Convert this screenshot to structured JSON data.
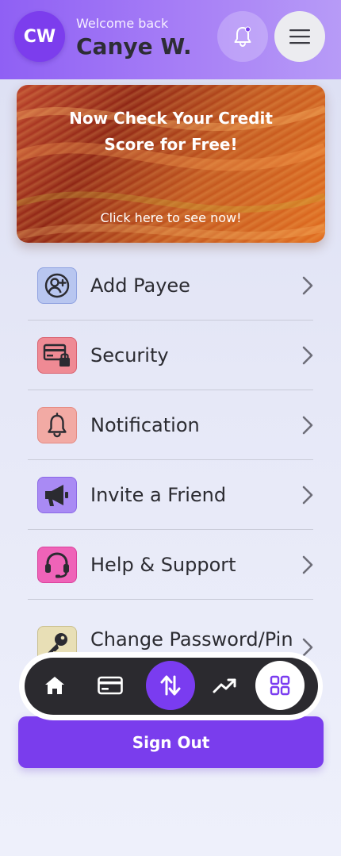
{
  "header": {
    "avatar_initials": "CW",
    "welcome_text": "Welcome back",
    "user_name": "Canye W.",
    "notification_icon": "bell-icon",
    "menu_icon": "hamburger-icon"
  },
  "promo": {
    "title": "Now Check Your Credit Score for Free!",
    "cta": "Click here to see now!"
  },
  "menu": {
    "items": [
      {
        "label": "Add Payee",
        "icon": "add-user-icon",
        "color": "#b8c6f0"
      },
      {
        "label": "Security",
        "icon": "card-lock-icon",
        "color": "#ef8a94"
      },
      {
        "label": "Notification",
        "icon": "bell-icon",
        "color": "#f2aaa4"
      },
      {
        "label": "Invite a Friend",
        "icon": "megaphone-icon",
        "color": "#a98af4"
      },
      {
        "label": "Help & Support",
        "icon": "headset-icon",
        "color": "#ef63b8"
      },
      {
        "label": "Change Password/Pin",
        "icon": "key-icon",
        "color": "#e8dfb6"
      }
    ]
  },
  "bottom_nav": {
    "items": [
      {
        "name": "home",
        "icon": "home-icon"
      },
      {
        "name": "cards",
        "icon": "credit-card-icon"
      },
      {
        "name": "transfer",
        "icon": "transfer-arrows-icon",
        "active_color": "#7a3cf0"
      },
      {
        "name": "analytics",
        "icon": "trend-up-icon"
      },
      {
        "name": "more",
        "icon": "grid-icon",
        "selected": true
      }
    ]
  },
  "actions": {
    "sign_out": "Sign Out"
  },
  "colors": {
    "accent": "#7a3ded",
    "header_gradient_start": "#8f60f4",
    "header_gradient_end": "#b79bf7"
  }
}
